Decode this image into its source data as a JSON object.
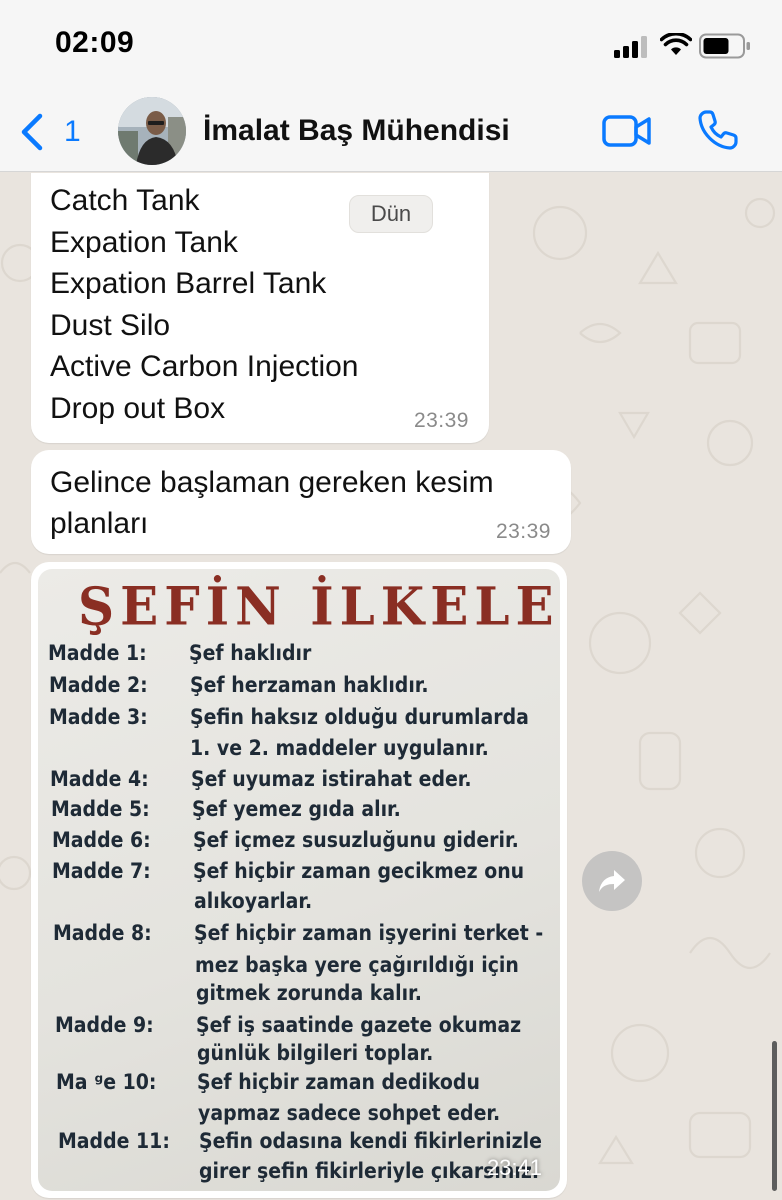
{
  "status_bar": {
    "time": "02:09"
  },
  "header": {
    "back_count": "1",
    "contact_name": "İmalat Baş Mühendisi"
  },
  "date_pill": "Dün",
  "messages": [
    {
      "lines": [
        "Catch Tank",
        "Expation Tank",
        "Expation Barrel Tank",
        "Dust Silo",
        "Active Carbon Injection",
        "Drop out Box"
      ],
      "time": "23:39"
    },
    {
      "text": "Gelince başlaman gereken kesim planları",
      "time": "23:39"
    },
    {
      "type": "image",
      "time": "23:41",
      "poster": {
        "title": "ŞEFİN İLKELERİ",
        "rows": [
          {
            "label": "Madde 1:",
            "text": "Şef haklıdır"
          },
          {
            "label": "Madde 2:",
            "text": "Şef herzaman haklıdır."
          },
          {
            "label": "Madde 3:",
            "text": "Şefin haksız olduğu durumlarda"
          },
          {
            "label": "",
            "text": "1. ve 2. maddeler uygulanır."
          },
          {
            "label": "Madde 4:",
            "text": "Şef uyumaz istirahat eder."
          },
          {
            "label": "Madde 5:",
            "text": "Şef yemez gıda alır."
          },
          {
            "label": "Madde 6:",
            "text": "Şef içmez susuzluğunu giderir."
          },
          {
            "label": "Madde 7:",
            "text": "Şef hiçbir zaman gecikmez onu"
          },
          {
            "label": "",
            "text": "alıkoyarlar."
          },
          {
            "label": "Madde 8:",
            "text": "Şef hiçbir zaman işyerini terket -"
          },
          {
            "label": "",
            "text": "mez başka yere çağırıldığı için"
          },
          {
            "label": "",
            "text": "gitmek zorunda kalır."
          },
          {
            "label": "Madde 9:",
            "text": "Şef iş saatinde gazete okumaz"
          },
          {
            "label": "",
            "text": "günlük bilgileri toplar."
          },
          {
            "label": "Ma ᵍe 10:",
            "text": "Şef hiçbir zaman dedikodu"
          },
          {
            "label": "",
            "text": "yapmaz sadece sohpet eder."
          },
          {
            "label": "Madde 11:",
            "text": "Şefin odasına kendi fikirlerinizle"
          },
          {
            "label": "",
            "text": "girer şefin fikirleriyle çıkarsınız."
          }
        ]
      }
    }
  ],
  "colors": {
    "accent": "#0a7aff",
    "chat_background": "#e9e4de",
    "bubble": "#ffffff",
    "poster_title": "#8a2e23",
    "poster_text": "#1e2a36"
  },
  "icons": [
    "signal-icon",
    "wifi-icon",
    "battery-icon",
    "back-chevron-icon",
    "video-camera-icon",
    "phone-icon",
    "forward-icon"
  ]
}
